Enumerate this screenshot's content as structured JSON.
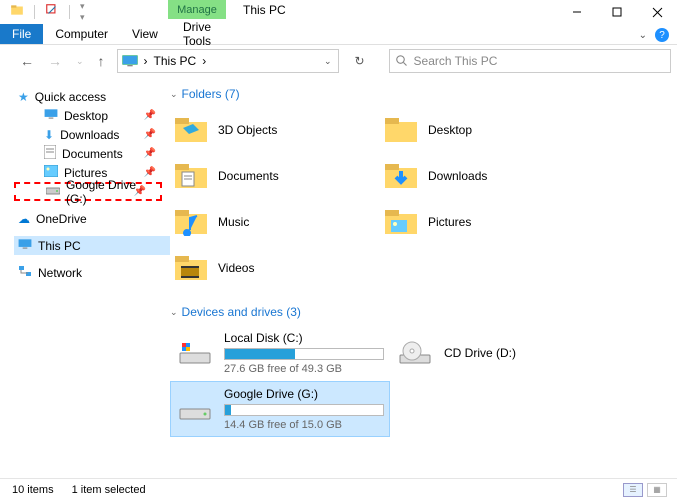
{
  "window": {
    "title": "This PC",
    "context_tab": "Manage",
    "context_sub": "Drive Tools"
  },
  "ribbon": {
    "file": "File",
    "computer": "Computer",
    "view": "View"
  },
  "address": {
    "location": "This PC",
    "sep": "›"
  },
  "search": {
    "placeholder": "Search This PC"
  },
  "sidebar": {
    "quick_access": "Quick access",
    "desktop": "Desktop",
    "downloads": "Downloads",
    "documents": "Documents",
    "pictures": "Pictures",
    "gdrive": "Google Drive (G:)",
    "onedrive": "OneDrive",
    "thispc": "This PC",
    "network": "Network"
  },
  "sections": {
    "folders_header": "Folders (7)",
    "drives_header": "Devices and drives (3)"
  },
  "folders": {
    "objects3d": "3D Objects",
    "desktop": "Desktop",
    "documents": "Documents",
    "downloads": "Downloads",
    "music": "Music",
    "pictures": "Pictures",
    "videos": "Videos"
  },
  "drives": {
    "local": {
      "name": "Local Disk (C:)",
      "free": "27.6 GB free of 49.3 GB",
      "fill_pct": 44
    },
    "cd": {
      "name": "CD Drive (D:)"
    },
    "google": {
      "name": "Google Drive (G:)",
      "free": "14.4 GB free of 15.0 GB",
      "fill_pct": 4
    }
  },
  "status": {
    "count": "10 items",
    "selected": "1 item selected"
  }
}
